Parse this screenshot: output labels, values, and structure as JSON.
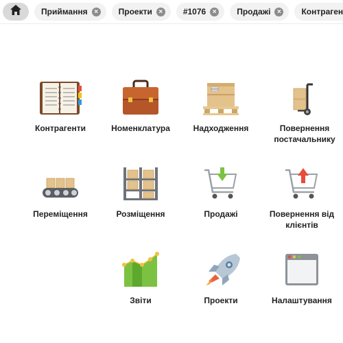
{
  "tabs": {
    "home_icon": "home-icon",
    "items": [
      {
        "label": "Приймання"
      },
      {
        "label": "Проекти"
      },
      {
        "label": "#1076"
      },
      {
        "label": "Продажі"
      },
      {
        "label": "Контрагенти"
      }
    ]
  },
  "menu": {
    "items": [
      {
        "label": "Контрагенти",
        "icon": "address-book-icon"
      },
      {
        "label": "Номенклатура",
        "icon": "briefcase-icon"
      },
      {
        "label": "Надходження",
        "icon": "boxes-on-pallet-icon"
      },
      {
        "label": "Повернення постачальнику",
        "icon": "hand-truck-icon"
      },
      {
        "label": "Переміщення",
        "icon": "conveyor-icon"
      },
      {
        "label": "Розміщення",
        "icon": "warehouse-shelf-icon"
      },
      {
        "label": "Продажі",
        "icon": "cart-arrow-down-icon"
      },
      {
        "label": "Повернення від клієнтів",
        "icon": "cart-arrow-up-icon"
      },
      {
        "label": "Звіти",
        "icon": "chart-icon"
      },
      {
        "label": "Проекти",
        "icon": "rocket-icon"
      },
      {
        "label": "Налаштування",
        "icon": "browser-window-icon"
      }
    ]
  }
}
